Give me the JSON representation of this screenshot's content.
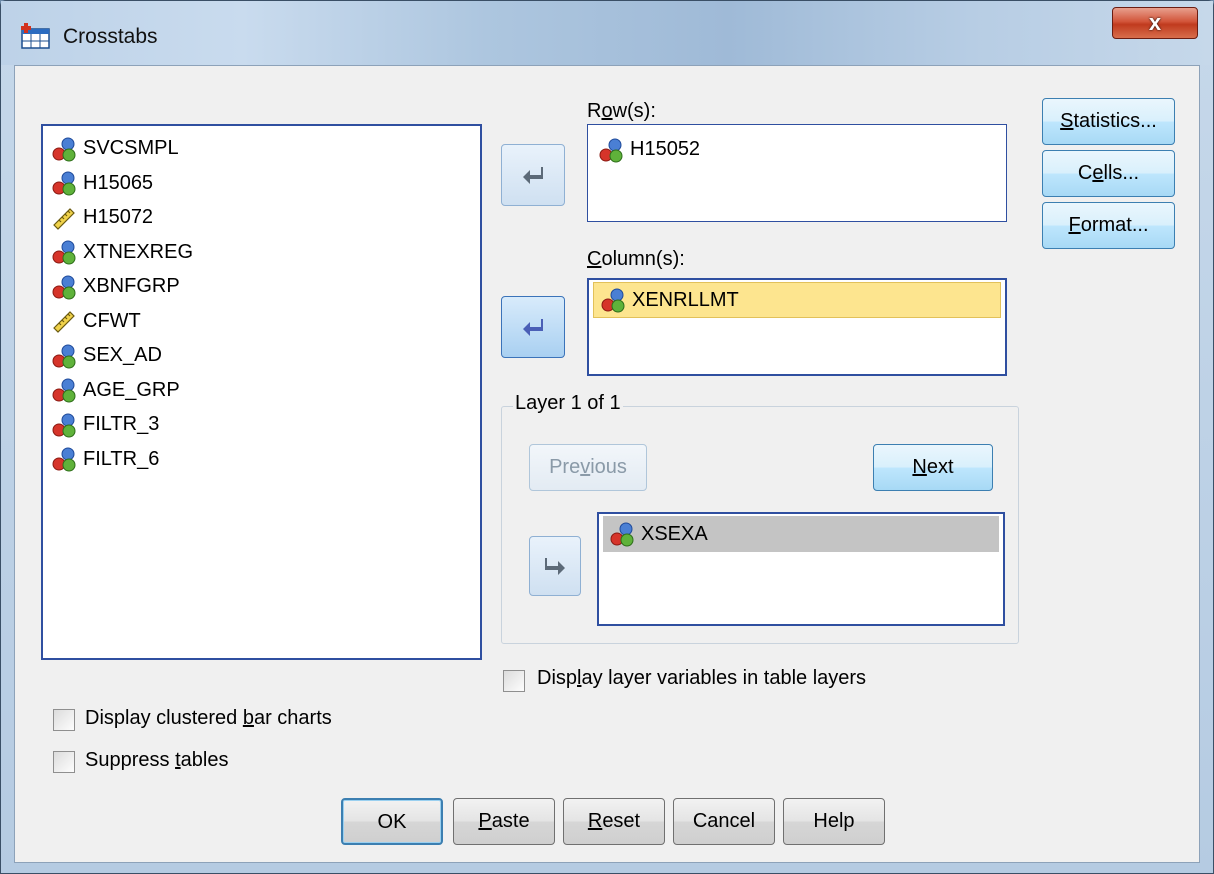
{
  "window": {
    "title": "Crosstabs",
    "close_label": "x"
  },
  "source_list": {
    "items": [
      {
        "name": "SVCSMPL",
        "icon": "nominal-icon"
      },
      {
        "name": "H15065",
        "icon": "nominal-icon"
      },
      {
        "name": "H15072",
        "icon": "scale-icon"
      },
      {
        "name": "XTNEXREG",
        "icon": "nominal-icon"
      },
      {
        "name": "XBNFGRP",
        "icon": "nominal-icon"
      },
      {
        "name": "CFWT",
        "icon": "scale-icon"
      },
      {
        "name": "SEX_AD",
        "icon": "nominal-icon"
      },
      {
        "name": "AGE_GRP",
        "icon": "nominal-icon"
      },
      {
        "name": "FILTR_3",
        "icon": "nominal-icon"
      },
      {
        "name": "FILTR_6",
        "icon": "nominal-icon"
      }
    ]
  },
  "rows": {
    "label_pre": "R",
    "label_ul": "o",
    "label_post": "w(s):",
    "items": [
      "H15052"
    ]
  },
  "columns": {
    "label_pre": "",
    "label_ul": "C",
    "label_post": "olumn(s):",
    "items": [
      "XENRLLMT"
    ]
  },
  "layer": {
    "label": "Layer 1 of 1",
    "previous_pre": "Pre",
    "previous_ul": "v",
    "previous_post": "ious",
    "next_pre": "",
    "next_ul": "N",
    "next_post": "ext",
    "items": [
      "XSEXA"
    ]
  },
  "side_buttons": {
    "statistics_ul": "S",
    "statistics_post": "tatistics...",
    "cells_pre": "C",
    "cells_ul": "e",
    "cells_post": "lls...",
    "format_ul": "F",
    "format_post": "ormat..."
  },
  "options": {
    "display_layer_pre": "Disp",
    "display_layer_ul": "l",
    "display_layer_post": "ay layer variables in table layers",
    "display_layer_checked": false,
    "clustered_pre": "Display clustered ",
    "clustered_ul": "b",
    "clustered_post": "ar charts",
    "clustered_checked": false,
    "suppress_pre": "Suppress ",
    "suppress_ul": "t",
    "suppress_post": "ables",
    "suppress_checked": false
  },
  "footer_buttons": {
    "ok": "OK",
    "paste_ul": "P",
    "paste_post": "aste",
    "reset_ul": "R",
    "reset_post": "eset",
    "cancel": "Cancel",
    "help": "Help"
  },
  "colors": {
    "selection_yellow": "#fde58f",
    "selection_gray": "#c4c4c4",
    "list_border": "#2f4fa0"
  }
}
